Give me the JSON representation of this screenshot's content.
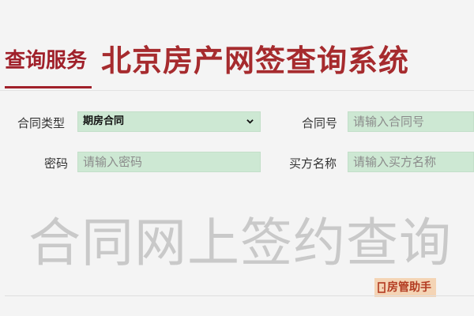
{
  "header": {
    "section_tag": "查询服务",
    "system_title": "北京房产网签查询系统"
  },
  "form": {
    "contract_type": {
      "label": "合同类型",
      "selected": "期房合同"
    },
    "contract_no": {
      "label": "合同号",
      "placeholder": "请输入合同号"
    },
    "password": {
      "label": "密码",
      "placeholder": "请输入密码"
    },
    "buyer_name": {
      "label": "买方名称",
      "placeholder": "请输入买方名称"
    }
  },
  "watermark": "合同网上签约查询",
  "badge": {
    "text": "房管助手",
    "icon": "door-icon"
  },
  "colors": {
    "brand": "#a0202a",
    "field_bg": "#cde8d3",
    "watermark": "#c9c9c9",
    "badge_bg": "#f4d4b5"
  }
}
